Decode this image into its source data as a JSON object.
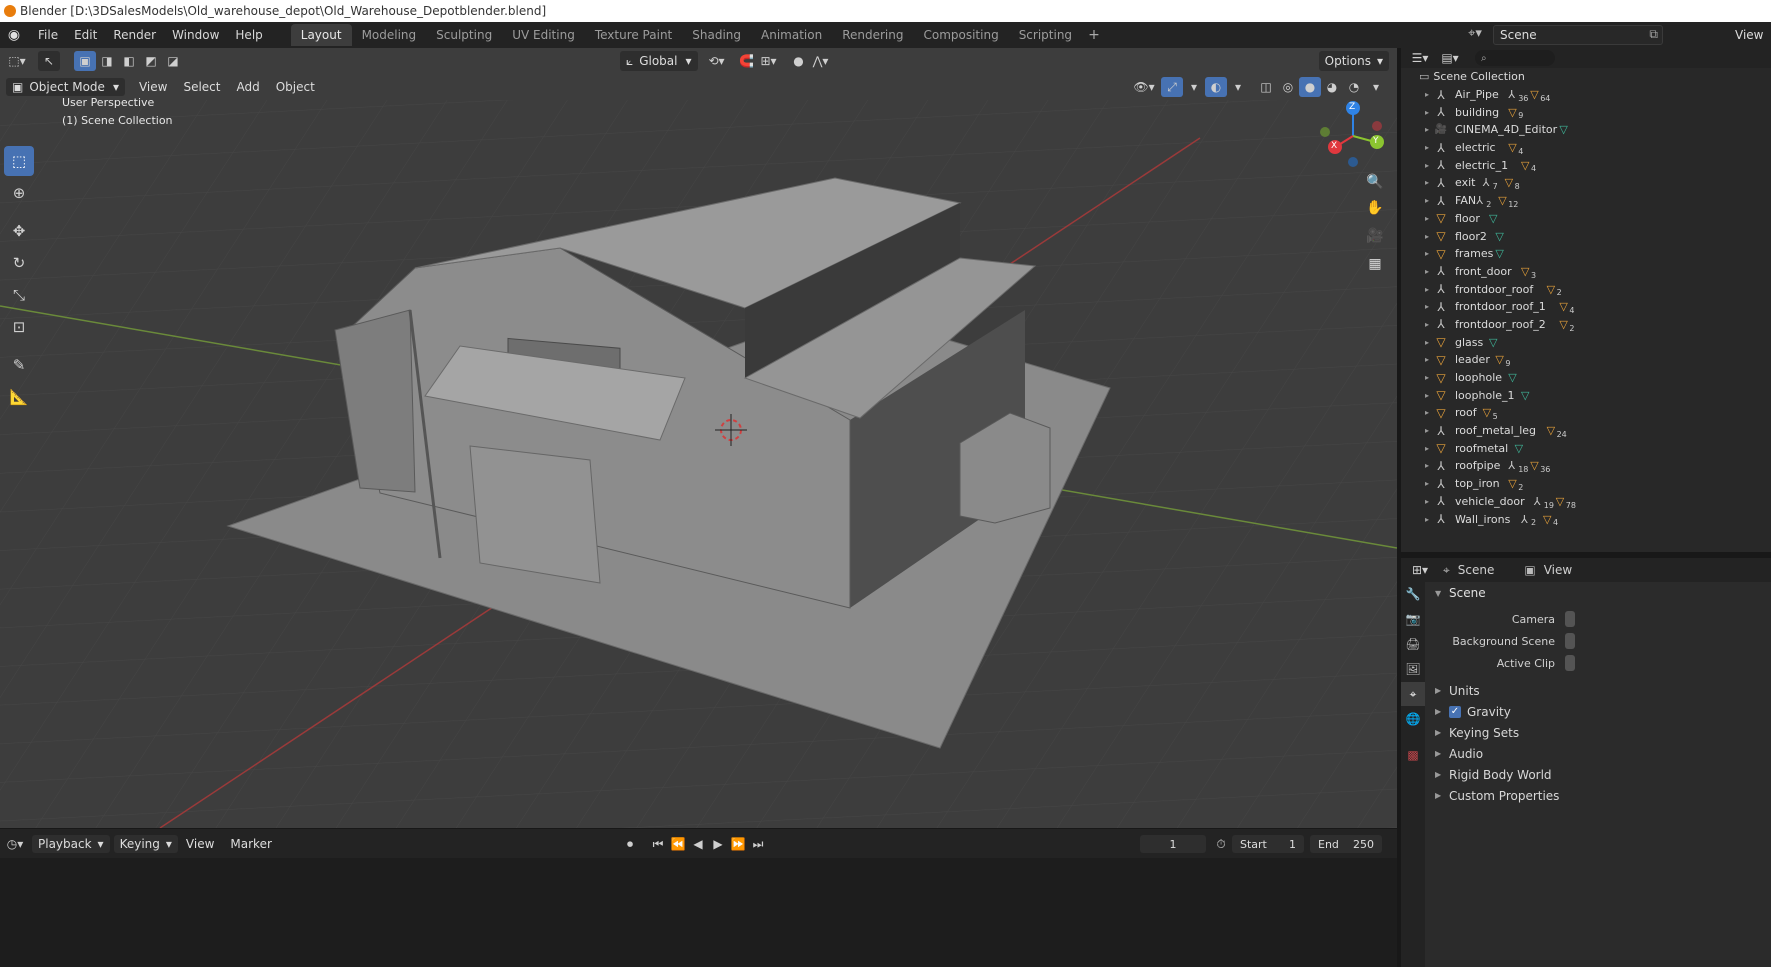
{
  "window": {
    "title": "Blender [D:\\3DSalesModels\\Old_warehouse_depot\\Old_Warehouse_Depotblender.blend]"
  },
  "menubar": {
    "menus": [
      "File",
      "Edit",
      "Render",
      "Window",
      "Help"
    ],
    "workspaces": [
      "Layout",
      "Modeling",
      "Sculpting",
      "UV Editing",
      "Texture Paint",
      "Shading",
      "Animation",
      "Rendering",
      "Compositing",
      "Scripting"
    ],
    "active_workspace": "Layout",
    "add_label": "+",
    "scene_name": "Scene",
    "view_layer_label": "View"
  },
  "viewport": {
    "mode": "Object Mode",
    "menus": [
      "View",
      "Select",
      "Add",
      "Object"
    ],
    "transform_orientation": "Global",
    "options_label": "Options",
    "overlay_line1": "User Perspective",
    "overlay_line2": "(1) Scene Collection",
    "gizmo_axes": {
      "x": "X",
      "y": "Y",
      "z": "Z"
    },
    "colors": {
      "x_axis": "#e0383e",
      "y_axis": "#8bc430",
      "z_axis": "#2f83e6",
      "active_tool": "#4772b3"
    }
  },
  "timeline": {
    "menus": [
      "Playback",
      "Keying",
      "View",
      "Marker"
    ],
    "current_frame": "1",
    "start_label": "Start",
    "start_value": "1",
    "end_label": "End",
    "end_value": "250"
  },
  "outliner": {
    "collection": "Scene Collection",
    "items": [
      {
        "name": "Air_Pipe",
        "icon": "empty",
        "counts": [
          "36",
          "64"
        ]
      },
      {
        "name": "building",
        "icon": "empty",
        "counts": [
          "9"
        ]
      },
      {
        "name": "CINEMA_4D_Editor",
        "icon": "camera",
        "counts": []
      },
      {
        "name": "electric",
        "icon": "empty",
        "counts": [
          "4"
        ]
      },
      {
        "name": "electric_1",
        "icon": "empty",
        "counts": [
          "4"
        ]
      },
      {
        "name": "exit",
        "icon": "empty",
        "counts": [
          "7",
          "8"
        ]
      },
      {
        "name": "FAN",
        "icon": "empty",
        "counts": [
          "2",
          "12"
        ]
      },
      {
        "name": "floor",
        "icon": "mesh",
        "counts": []
      },
      {
        "name": "floor2",
        "icon": "mesh",
        "counts": []
      },
      {
        "name": "frames",
        "icon": "mesh",
        "counts": []
      },
      {
        "name": "front_door",
        "icon": "empty",
        "counts": [
          "3"
        ]
      },
      {
        "name": "frontdoor_roof",
        "icon": "empty",
        "counts": [
          "2"
        ]
      },
      {
        "name": "frontdoor_roof_1",
        "icon": "empty",
        "counts": [
          "4"
        ]
      },
      {
        "name": "frontdoor_roof_2",
        "icon": "empty",
        "counts": [
          "2"
        ]
      },
      {
        "name": "glass",
        "icon": "mesh",
        "counts": []
      },
      {
        "name": "leader",
        "icon": "mesh",
        "counts": [
          "9"
        ]
      },
      {
        "name": "loophole",
        "icon": "mesh",
        "counts": []
      },
      {
        "name": "loophole_1",
        "icon": "mesh",
        "counts": []
      },
      {
        "name": "roof",
        "icon": "mesh",
        "counts": [
          "5"
        ]
      },
      {
        "name": "roof_metal_leg",
        "icon": "empty",
        "counts": [
          "24"
        ]
      },
      {
        "name": "roofmetal",
        "icon": "mesh",
        "counts": []
      },
      {
        "name": "roofpipe",
        "icon": "empty",
        "counts": [
          "18",
          "36"
        ]
      },
      {
        "name": "top_iron",
        "icon": "empty",
        "counts": [
          "2"
        ]
      },
      {
        "name": "vehicle_door",
        "icon": "empty",
        "counts": [
          "19",
          "78"
        ]
      },
      {
        "name": "Wall_irons",
        "icon": "empty",
        "counts": [
          "2",
          "4"
        ]
      }
    ]
  },
  "properties": {
    "header_scene": "Scene",
    "header_view": "View",
    "panel_title": "Scene",
    "fields": [
      {
        "label": "Camera"
      },
      {
        "label": "Background Scene"
      },
      {
        "label": "Active Clip"
      }
    ],
    "subpanels": [
      "Units",
      "Gravity",
      "Keying Sets",
      "Audio",
      "Rigid Body World",
      "Custom Properties"
    ],
    "gravity_checked": true
  }
}
